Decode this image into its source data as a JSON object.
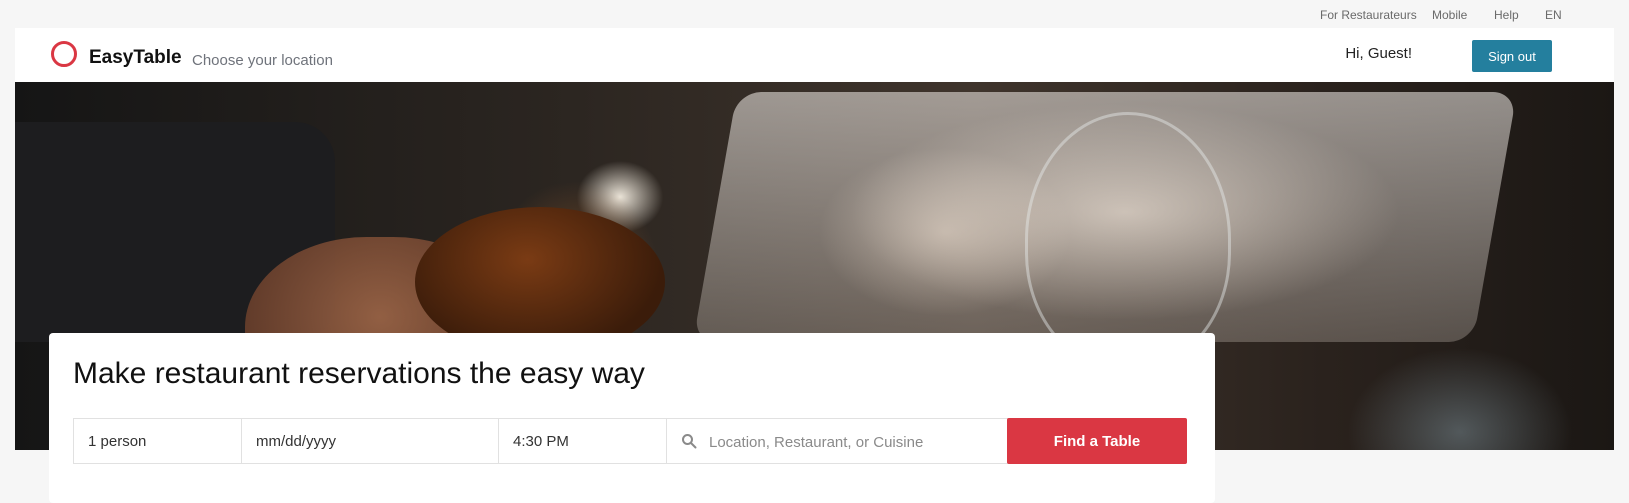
{
  "utility_nav": {
    "links": [
      "For Restaurateurs",
      "Mobile",
      "Help",
      "EN"
    ]
  },
  "header": {
    "brand": "EasyTable",
    "location_prompt": "Choose your location",
    "greeting": "Hi, Guest!",
    "signout_label": "Sign out"
  },
  "colors": {
    "brand_red": "#da3743",
    "signout_blue": "#247f9e"
  },
  "icons": {
    "logo": "ring-logo-icon",
    "search": "search-icon"
  },
  "search": {
    "headline": "Make restaurant reservations the easy way",
    "party_size": "1 person",
    "date": "mm/dd/yyyy",
    "time": "4:30 PM",
    "query_placeholder": "Location, Restaurant, or Cuisine",
    "submit_label": "Find a Table"
  }
}
